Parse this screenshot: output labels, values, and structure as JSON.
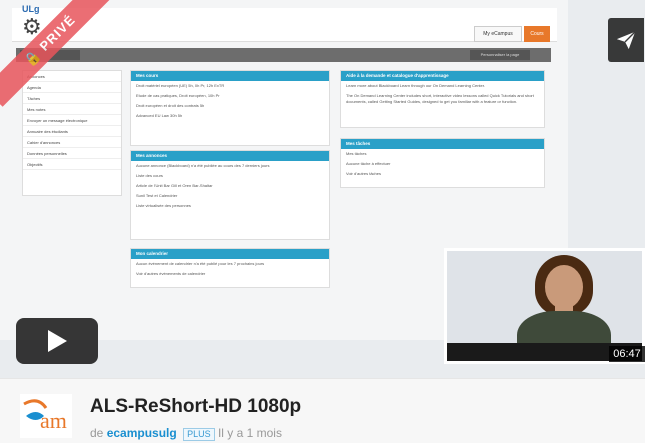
{
  "video": {
    "ribbon_text": "PRIVÉ",
    "duration": "06:47"
  },
  "lms": {
    "logo_text": "ULg",
    "tabs": {
      "my_ecampus": "My eCampus",
      "cours": "Cours"
    },
    "bar_right": "Personnaliser la page",
    "sidebar_items": [
      "Annonces",
      "Agenda",
      "Tâches",
      "Mes notes",
      "Envoyer un message électronique",
      "Annuaire des étudiants",
      "Cahier d'annonces",
      "Données personnelles",
      "Objectifs"
    ],
    "panels": {
      "mes_cours": {
        "title": "Mes cours",
        "lines": [
          "Droit matériel européen (UE) 5h, 0h Pr, 12h ExTR",
          "Etude de cas pratiques, Droit européen, 10h Pr",
          "Droit européen et droit des contrats 5h",
          "Advanced EU Law 30h 5h"
        ]
      },
      "mes_annonces": {
        "title": "Mes annonces",
        "lines": [
          "Aucune annonce (Blackboard) n'a été publiée au cours des 7 derniers jours",
          "Liste des cours",
          "Article de l'Unit Bar Gill et Oren Bar-Shaltar",
          "Sunil Test et Calendrier",
          "Liste virtualisée des personnes"
        ]
      },
      "mes_calendrier": {
        "title": "Mon calendrier",
        "lines": [
          "Aucun événement de calendrier n'a été publié pour les 7 prochains jours",
          "Voir d'autres événements de calendrier"
        ]
      },
      "aide": {
        "title": "Aide à la demande et catalogue d'apprentissage",
        "lines": [
          "Learn more about Blackboard Learn through our On Demand Learning Center.",
          "The On Demand Learning Center includes short, interactive video lessons called Quick Tutorials and short documents, called Getting Started Guides, designed to get you familiar with a feature or function."
        ]
      },
      "mes_taches": {
        "title": "Mes tâches",
        "lines": [
          "Mes tâches",
          "Aucune tâche à effectuer",
          "Voir d'autres tâches"
        ]
      }
    }
  },
  "info": {
    "title": "ALS-ReShort-HD 1080p",
    "by_prefix": "de",
    "owner": "ecampusulg",
    "badge": "PLUS",
    "date": "Il y a 1 mois"
  }
}
